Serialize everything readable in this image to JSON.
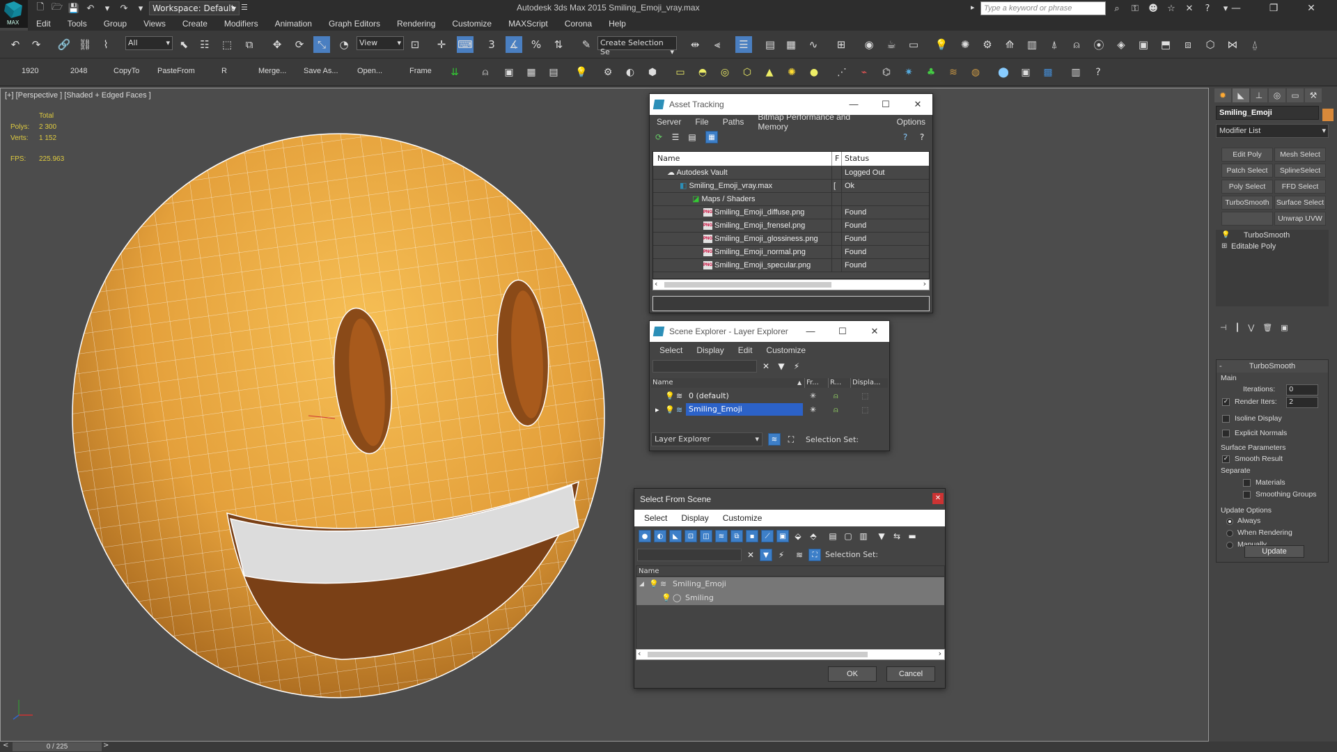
{
  "app": {
    "logo_text": "MAX",
    "window_title": "Autodesk 3ds Max  2015     Smiling_Emoji_vray.max",
    "workspace": "Workspace: Default",
    "search_placeholder": "Type a keyword or phrase"
  },
  "menu": [
    "Edit",
    "Tools",
    "Group",
    "Views",
    "Create",
    "Modifiers",
    "Animation",
    "Graph Editors",
    "Rendering",
    "Customize",
    "MAXScript",
    "Corona",
    "Help"
  ],
  "main_toolbar": {
    "selection_filter": "All",
    "ref_coord": "View",
    "selection_set": "Create Selection Se",
    "snap_label": "3"
  },
  "second_toolbar": {
    "buttons": [
      "1920",
      "2048",
      "CopyTo",
      "PasteFrom",
      "R",
      "Merge...",
      "Save As...",
      "Open...",
      "Frame"
    ]
  },
  "viewport": {
    "label": "[+] [Perspective ] [Shaded + Edged Faces ]",
    "stats": {
      "total_label": "Total",
      "polys_label": "Polys:",
      "polys_value": "2 300",
      "verts_label": "Verts:",
      "verts_value": "1 152",
      "fps_label": "FPS:",
      "fps_value": "225.963"
    },
    "colors": {
      "face": "#e8a53c",
      "mouth": "#7a4016",
      "teeth": "#dcdcdc",
      "wire": "#ffffff"
    }
  },
  "command_panel": {
    "object_name": "Smiling_Emoji",
    "object_color": "#d8893a",
    "modifier_list": "Modifier List",
    "modifier_buttons": [
      "Edit Poly",
      "Mesh Select",
      "Patch Select",
      "SplineSelect",
      "Poly Select",
      "FFD Select",
      "TurboSmooth",
      "Surface Select",
      "",
      "Unwrap UVW"
    ],
    "stack": [
      "TurboSmooth",
      "Editable Poly"
    ],
    "rollout": {
      "title": "TurboSmooth",
      "main_label": "Main",
      "iterations_label": "Iterations:",
      "iterations_value": "0",
      "render_iters_label": "Render Iters:",
      "render_iters_value": "2",
      "isoline_label": "Isoline Display",
      "explicit_normals_label": "Explicit Normals",
      "surface_params_label": "Surface Parameters",
      "smooth_result_label": "Smooth Result",
      "separate_label": "Separate",
      "materials_label": "Materials",
      "smoothing_groups_label": "Smoothing Groups",
      "update_options_label": "Update Options",
      "always_label": "Always",
      "when_rendering_label": "When Rendering",
      "manually_label": "Manually",
      "update_button": "Update"
    }
  },
  "status_bar": {
    "timeline": "0 / 225"
  },
  "asset_tracking": {
    "title": "Asset Tracking",
    "menu": [
      "Server",
      "File",
      "Paths",
      "Bitmap Performance and Memory",
      "Options"
    ],
    "columns": {
      "name": "Name",
      "f": "F",
      "status": "Status"
    },
    "rows": [
      {
        "name": "Autodesk Vault",
        "f": "",
        "status": "Logged Out"
      },
      {
        "name": "Smiling_Emoji_vray.max",
        "f": "[",
        "status": "Ok"
      },
      {
        "name": "Maps / Shaders",
        "f": "",
        "status": ""
      },
      {
        "name": "Smiling_Emoji_diffuse.png",
        "f": "",
        "status": "Found"
      },
      {
        "name": "Smiling_Emoji_frensel.png",
        "f": "",
        "status": "Found"
      },
      {
        "name": "Smiling_Emoji_glossiness.png",
        "f": "",
        "status": "Found"
      },
      {
        "name": "Smiling_Emoji_normal.png",
        "f": "",
        "status": "Found"
      },
      {
        "name": "Smiling_Emoji_specular.png",
        "f": "",
        "status": "Found"
      }
    ]
  },
  "scene_explorer": {
    "title": "Scene Explorer - Layer Explorer",
    "menu": [
      "Select",
      "Display",
      "Edit",
      "Customize"
    ],
    "columns": {
      "name": "Name",
      "frozen": "Fr...",
      "render": "R...",
      "display": "Displa..."
    },
    "rows": [
      {
        "name": "0 (default)",
        "selected": false
      },
      {
        "name": "Smiling_Emoji",
        "selected": true
      }
    ],
    "footer_combo": "Layer Explorer",
    "selection_set_label": "Selection Set:"
  },
  "select_from_scene": {
    "title": "Select From Scene",
    "menu": [
      "Select",
      "Display",
      "Customize"
    ],
    "selection_set_label": "Selection Set:",
    "column_name": "Name",
    "rows": [
      "Smiling_Emoji",
      "Smiling"
    ],
    "ok": "OK",
    "cancel": "Cancel"
  }
}
